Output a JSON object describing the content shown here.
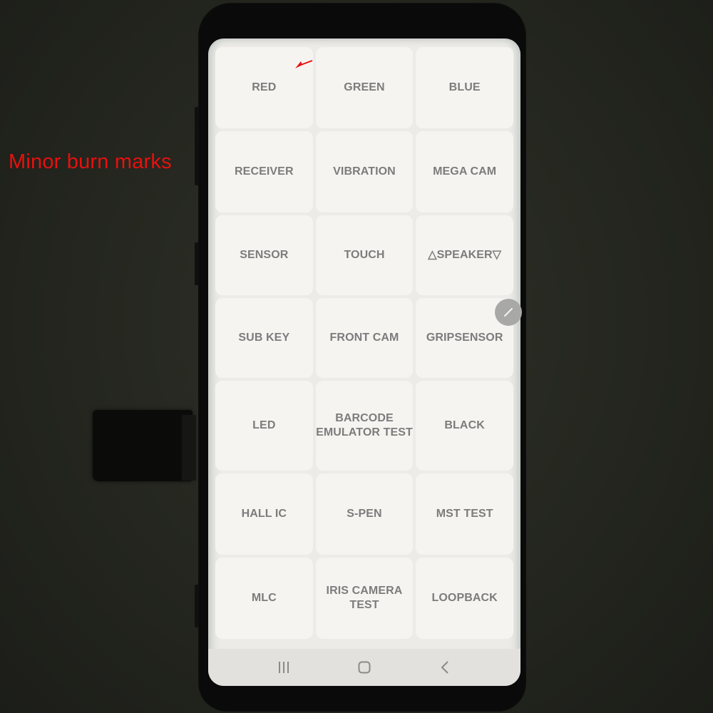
{
  "annotation": {
    "text": "Minor burn marks",
    "color": "#e8100e"
  },
  "screen": {
    "tiles": [
      {
        "label": "RED"
      },
      {
        "label": "GREEN"
      },
      {
        "label": "BLUE"
      },
      {
        "label": "RECEIVER"
      },
      {
        "label": "VIBRATION"
      },
      {
        "label": "MEGA CAM"
      },
      {
        "label": "SENSOR"
      },
      {
        "label": "TOUCH"
      },
      {
        "label": "△SPEAKER▽"
      },
      {
        "label": "SUB KEY"
      },
      {
        "label": "FRONT CAM"
      },
      {
        "label": "GRIPSENSOR"
      },
      {
        "label": "LED"
      },
      {
        "label": "BARCODE\nEMULATOR TEST"
      },
      {
        "label": "BLACK"
      },
      {
        "label": "HALL IC"
      },
      {
        "label": "S-PEN"
      },
      {
        "label": "MST TEST"
      },
      {
        "label": "MLC"
      },
      {
        "label": "IRIS CAMERA TEST"
      },
      {
        "label": "LOOPBACK"
      }
    ],
    "navbar": {
      "recents_icon": "recents-icon",
      "home_icon": "home-icon",
      "back_icon": "back-icon"
    },
    "floating_button_icon": "pen-icon"
  },
  "colors": {
    "tile_text": "#7c7c7c",
    "tile_bg": "#f5f4f1",
    "screen_bg": "#ecebe8"
  }
}
